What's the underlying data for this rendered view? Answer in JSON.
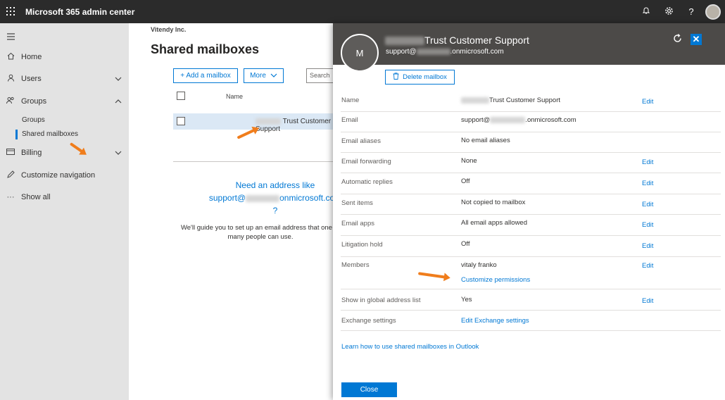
{
  "topbar": {
    "app_title": "Microsoft 365 admin center",
    "icons": [
      "bell-icon",
      "gear-icon",
      "help-icon",
      "profile-avatar"
    ]
  },
  "nav": {
    "items": [
      {
        "label": "Home",
        "icon": "home-icon"
      },
      {
        "label": "Users",
        "icon": "user-icon",
        "chevron": "down"
      },
      {
        "label": "Groups",
        "icon": "groups-icon",
        "chevron": "up"
      },
      {
        "label": "Billing",
        "icon": "billing-icon",
        "chevron": "down"
      },
      {
        "label": "Customize navigation",
        "icon": "pencil-icon"
      },
      {
        "label": "Show all",
        "icon": "ellipsis-icon"
      }
    ],
    "sub_items": [
      {
        "label": "Groups"
      },
      {
        "label": "Shared mailboxes",
        "active": true
      }
    ]
  },
  "main": {
    "org_name": "Vitendy Inc.",
    "page_title": "Shared mailboxes",
    "add_button": "+ Add a mailbox",
    "more_button": "More",
    "search_placeholder": "Search",
    "column_name": "Name",
    "row_name": "Trust Customer Support",
    "promo_line1": "Need an address like",
    "promo_line2a": "support@",
    "promo_line2b": "onmicrosoft.com",
    "promo_line3": "?",
    "promo_body": "We'll guide you to set up an email address that one or many people can use."
  },
  "panel": {
    "avatar_initial": "M",
    "title": "Trust Customer Support",
    "subtitle_a": "support@",
    "subtitle_b": ".onmicrosoft.com",
    "delete_button": "Delete mailbox",
    "edit_label": "Edit",
    "props": {
      "name": {
        "label": "Name",
        "value": "Trust Customer Support"
      },
      "email": {
        "label": "Email",
        "value_a": "support@",
        "value_b": ".onmicrosoft.com"
      },
      "aliases": {
        "label": "Email aliases",
        "value": "No email aliases"
      },
      "forwarding": {
        "label": "Email forwarding",
        "value": "None"
      },
      "auto_replies": {
        "label": "Automatic replies",
        "value": "Off"
      },
      "sent_items": {
        "label": "Sent items",
        "value": "Not copied to mailbox"
      },
      "email_apps": {
        "label": "Email apps",
        "value": "All email apps allowed"
      },
      "litigation": {
        "label": "Litigation hold",
        "value": "Off"
      },
      "members": {
        "label": "Members",
        "value": "vitaly franko",
        "link": "Customize permissions"
      },
      "gal": {
        "label": "Show in global address list",
        "value": "Yes"
      },
      "exchange": {
        "label": "Exchange settings",
        "link": "Edit Exchange settings"
      }
    },
    "learn_link": "Learn how to use shared mailboxes in Outlook",
    "close_button": "Close"
  }
}
